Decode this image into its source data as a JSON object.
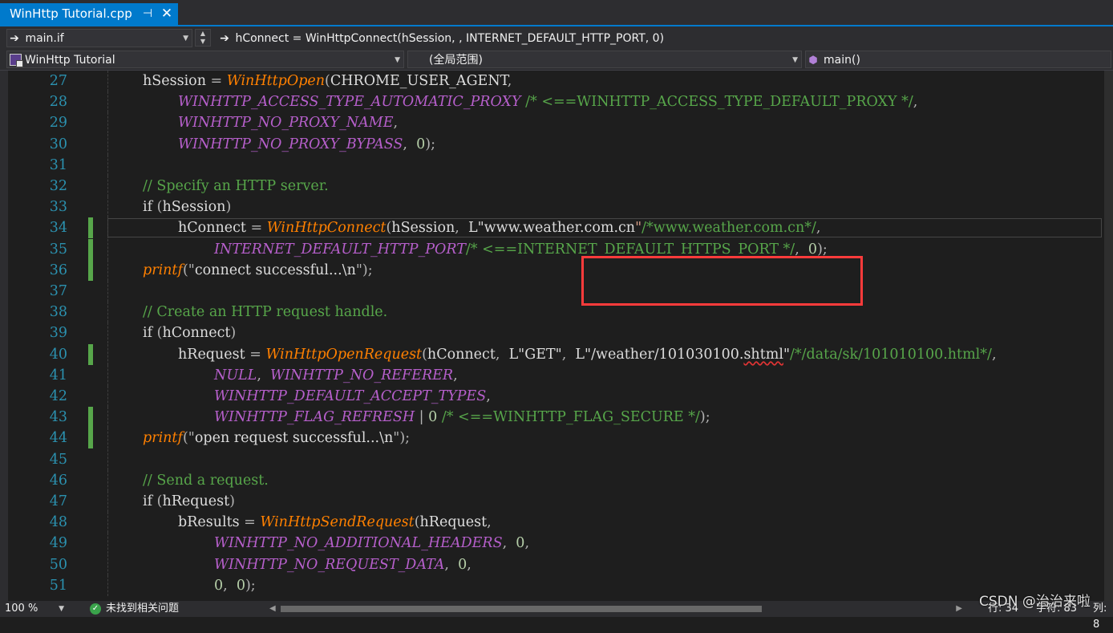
{
  "tab": {
    "title": "WinHttp Tutorial.cpp",
    "pin_glyph": "⊣",
    "close_glyph": "✕"
  },
  "nav": {
    "file_dropdown": "main.if",
    "member_dropdown": "hConnect = WinHttpConnect(hSession, , INTERNET_DEFAULT_HTTP_PORT, 0)",
    "project_dropdown": "WinHttp Tutorial",
    "scope_dropdown": "(全局范围)",
    "function_dropdown": "main()"
  },
  "editor": {
    "lines": [
      {
        "n": "27",
        "indent": 1,
        "changed": false,
        "tokens": [
          {
            "t": "hSession ",
            "c": "id"
          },
          {
            "t": "= ",
            "c": "pun"
          },
          {
            "t": "WinHttpOpen",
            "c": "fn"
          },
          {
            "t": "(",
            "c": "pun"
          },
          {
            "t": "CHROME_USER_AGENT",
            "c": "mac2"
          },
          {
            "t": ",",
            "c": "pun"
          }
        ]
      },
      {
        "n": "28",
        "indent": 2,
        "changed": false,
        "tokens": [
          {
            "t": "WINHTTP_ACCESS_TYPE_AUTOMATIC_PROXY",
            "c": "mac"
          },
          {
            "t": " /* <==WINHTTP_ACCESS_TYPE_DEFAULT_PROXY */",
            "c": "cm"
          },
          {
            "t": ",",
            "c": "pun"
          }
        ]
      },
      {
        "n": "29",
        "indent": 2,
        "changed": false,
        "tokens": [
          {
            "t": "WINHTTP_NO_PROXY_NAME",
            "c": "mac"
          },
          {
            "t": ",",
            "c": "pun"
          }
        ]
      },
      {
        "n": "30",
        "indent": 2,
        "changed": false,
        "tokens": [
          {
            "t": "WINHTTP_NO_PROXY_BYPASS",
            "c": "mac"
          },
          {
            "t": ",  ",
            "c": "pun"
          },
          {
            "t": "0",
            "c": "num"
          },
          {
            "t": ");",
            "c": "pun"
          }
        ]
      },
      {
        "n": "31",
        "indent": 1,
        "changed": false,
        "tokens": []
      },
      {
        "n": "32",
        "indent": 1,
        "changed": false,
        "tokens": [
          {
            "t": "// Specify an HTTP server.",
            "c": "cm"
          }
        ]
      },
      {
        "n": "33",
        "indent": 1,
        "changed": false,
        "tokens": [
          {
            "t": "if ",
            "c": "kw"
          },
          {
            "t": "(",
            "c": "pun"
          },
          {
            "t": "hSession",
            "c": "id"
          },
          {
            "t": ")",
            "c": "pun"
          }
        ]
      },
      {
        "n": "34",
        "indent": 2,
        "changed": true,
        "tokens": [
          {
            "t": "hConnect ",
            "c": "id"
          },
          {
            "t": "= ",
            "c": "pun"
          },
          {
            "t": "WinHttpConnect",
            "c": "fn"
          },
          {
            "t": "(",
            "c": "pun"
          },
          {
            "t": "hSession",
            "c": "id"
          },
          {
            "t": ",  ",
            "c": "pun"
          },
          {
            "t": "L\"",
            "c": "id"
          },
          {
            "t": "www.weather.com.cn",
            "c": "id"
          },
          {
            "t": "\"",
            "c": "str"
          },
          {
            "t": "/*www.weather.com.cn*/",
            "c": "cm"
          },
          {
            "t": ",",
            "c": "pun"
          }
        ]
      },
      {
        "n": "35",
        "indent": 3,
        "changed": true,
        "tokens": [
          {
            "t": "INTERNET_DEFAULT_HTTP_PORT",
            "c": "mac"
          },
          {
            "t": "/* <==INTERNET_DEFAULT_HTTPS_PORT */",
            "c": "cm"
          },
          {
            "t": ",  ",
            "c": "pun"
          },
          {
            "t": "0",
            "c": "num"
          },
          {
            "t": ");",
            "c": "pun"
          }
        ]
      },
      {
        "n": "36",
        "indent": 1,
        "changed": true,
        "tokens": [
          {
            "t": "printf",
            "c": "fn"
          },
          {
            "t": "(\"",
            "c": "pun"
          },
          {
            "t": "connect successful...\\n",
            "c": "id"
          },
          {
            "t": "\");",
            "c": "pun"
          }
        ]
      },
      {
        "n": "37",
        "indent": 1,
        "changed": false,
        "tokens": []
      },
      {
        "n": "38",
        "indent": 1,
        "changed": false,
        "tokens": [
          {
            "t": "// Create an HTTP request handle.",
            "c": "cm"
          }
        ]
      },
      {
        "n": "39",
        "indent": 1,
        "changed": false,
        "tokens": [
          {
            "t": "if ",
            "c": "kw"
          },
          {
            "t": "(",
            "c": "pun"
          },
          {
            "t": "hConnect",
            "c": "id"
          },
          {
            "t": ")",
            "c": "pun"
          }
        ]
      },
      {
        "n": "40",
        "indent": 2,
        "changed": true,
        "tokens": [
          {
            "t": "hRequest ",
            "c": "id"
          },
          {
            "t": "= ",
            "c": "pun"
          },
          {
            "t": "WinHttpOpenRequest",
            "c": "fn"
          },
          {
            "t": "(",
            "c": "pun"
          },
          {
            "t": "hConnect",
            "c": "id"
          },
          {
            "t": ",  ",
            "c": "pun"
          },
          {
            "t": "L\"GET\"",
            "c": "id"
          },
          {
            "t": ",  ",
            "c": "pun"
          },
          {
            "t": "L\"/weather/101030100.",
            "c": "id"
          },
          {
            "t": "shtml",
            "c": "sq"
          },
          {
            "t": "\"",
            "c": "id"
          },
          {
            "t": "/*/data/sk/101010100.html*/",
            "c": "cm"
          },
          {
            "t": ",",
            "c": "pun"
          }
        ]
      },
      {
        "n": "41",
        "indent": 3,
        "changed": false,
        "tokens": [
          {
            "t": "NULL",
            "c": "mac"
          },
          {
            "t": ",  ",
            "c": "pun"
          },
          {
            "t": "WINHTTP_NO_REFERER",
            "c": "mac"
          },
          {
            "t": ",",
            "c": "pun"
          }
        ]
      },
      {
        "n": "42",
        "indent": 3,
        "changed": false,
        "tokens": [
          {
            "t": "WINHTTP_DEFAULT_ACCEPT_TYPES",
            "c": "mac"
          },
          {
            "t": ",",
            "c": "pun"
          }
        ]
      },
      {
        "n": "43",
        "indent": 3,
        "changed": true,
        "tokens": [
          {
            "t": "WINHTTP_FLAG_REFRESH",
            "c": "mac"
          },
          {
            "t": " | ",
            "c": "pun"
          },
          {
            "t": "0",
            "c": "num"
          },
          {
            "t": " /* <==WINHTTP_FLAG_SECURE */",
            "c": "cm"
          },
          {
            "t": ");",
            "c": "pun"
          }
        ]
      },
      {
        "n": "44",
        "indent": 1,
        "changed": true,
        "tokens": [
          {
            "t": "printf",
            "c": "fn"
          },
          {
            "t": "(\"",
            "c": "pun"
          },
          {
            "t": "open request successful...\\n",
            "c": "id"
          },
          {
            "t": "\");",
            "c": "pun"
          }
        ]
      },
      {
        "n": "45",
        "indent": 1,
        "changed": false,
        "tokens": []
      },
      {
        "n": "46",
        "indent": 1,
        "changed": false,
        "tokens": [
          {
            "t": "// Send a request.",
            "c": "cm"
          }
        ]
      },
      {
        "n": "47",
        "indent": 1,
        "changed": false,
        "tokens": [
          {
            "t": "if ",
            "c": "kw"
          },
          {
            "t": "(",
            "c": "pun"
          },
          {
            "t": "hRequest",
            "c": "id"
          },
          {
            "t": ")",
            "c": "pun"
          }
        ]
      },
      {
        "n": "48",
        "indent": 2,
        "changed": false,
        "tokens": [
          {
            "t": "bResults ",
            "c": "id"
          },
          {
            "t": "= ",
            "c": "pun"
          },
          {
            "t": "WinHttpSendRequest",
            "c": "fn"
          },
          {
            "t": "(",
            "c": "pun"
          },
          {
            "t": "hRequest",
            "c": "id"
          },
          {
            "t": ",",
            "c": "pun"
          }
        ]
      },
      {
        "n": "49",
        "indent": 3,
        "changed": false,
        "tokens": [
          {
            "t": "WINHTTP_NO_ADDITIONAL_HEADERS",
            "c": "mac"
          },
          {
            "t": ",  ",
            "c": "pun"
          },
          {
            "t": "0",
            "c": "num"
          },
          {
            "t": ",",
            "c": "pun"
          }
        ]
      },
      {
        "n": "50",
        "indent": 3,
        "changed": false,
        "tokens": [
          {
            "t": "WINHTTP_NO_REQUEST_DATA",
            "c": "mac"
          },
          {
            "t": ",  ",
            "c": "pun"
          },
          {
            "t": "0",
            "c": "num"
          },
          {
            "t": ",",
            "c": "pun"
          }
        ]
      },
      {
        "n": "51",
        "indent": 3,
        "changed": false,
        "tokens": [
          {
            "t": "0",
            "c": "num"
          },
          {
            "t": ",  ",
            "c": "pun"
          },
          {
            "t": "0",
            "c": "num"
          },
          {
            "t": ");",
            "c": "pun"
          }
        ]
      }
    ]
  },
  "status": {
    "zoom": "100 %",
    "issues": "未找到相关问题",
    "row": "行: 34",
    "char": "字符: 83",
    "col": "列: 8"
  },
  "watermark": "CSDN @治治来啦",
  "colors": {
    "accent": "#007acc",
    "function": "#ff8000",
    "macro": "#b65fcb",
    "comment": "#57a64a",
    "line_number": "#2b91af",
    "highlight_box": "#ff3b3b",
    "change_marker": "#57a64a"
  }
}
